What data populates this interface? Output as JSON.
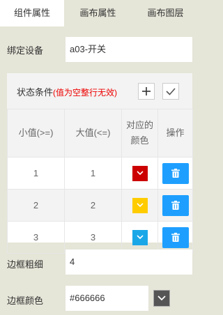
{
  "tabs": [
    {
      "label": "组件属性"
    },
    {
      "label": "画布属性"
    },
    {
      "label": "画布图层"
    }
  ],
  "bind_device": {
    "label": "绑定设备",
    "value": "a03-开关"
  },
  "state_condition": {
    "title": "状态条件",
    "note": "(值为空整行无效)",
    "add_icon": "plus-icon",
    "confirm_icon": "check-icon",
    "headers": {
      "min": "小值(>=)",
      "max": "大值(<=)",
      "color_line1": "对应的",
      "color_line2": "颜色",
      "action": "操作"
    },
    "rows": [
      {
        "min": "1",
        "max": "1",
        "color": "#cc0000"
      },
      {
        "min": "2",
        "max": "2",
        "color": "#ffcc00"
      },
      {
        "min": "3",
        "max": "3",
        "color": "#1aa7e8"
      }
    ],
    "delete_icon": "trash-icon",
    "delete_color": "#1e9fff"
  },
  "border_width": {
    "label": "边框粗细",
    "value": "4"
  },
  "border_color": {
    "label": "边框颜色",
    "value": "#666666",
    "picker_icon": "chevron-down-icon"
  }
}
